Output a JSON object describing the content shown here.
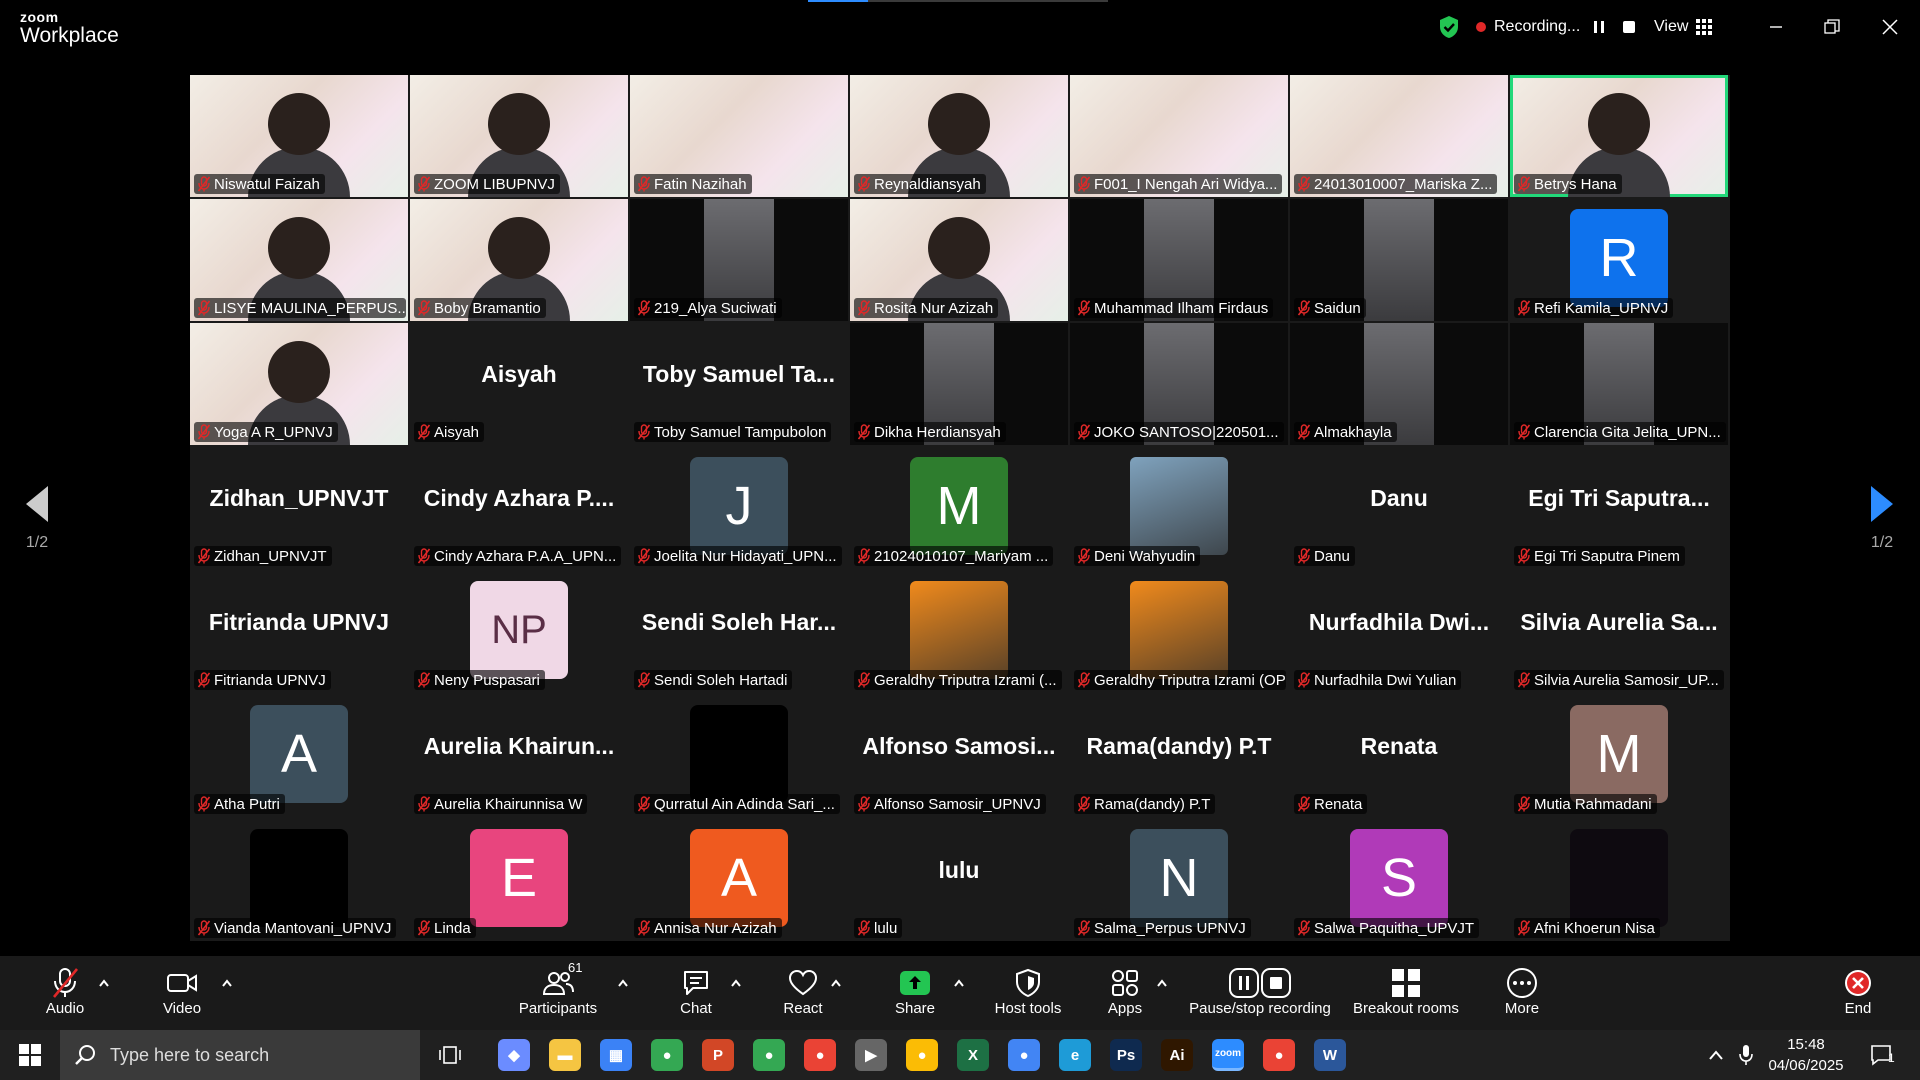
{
  "app": {
    "logo_top": "zoom",
    "logo_bottom": "Workplace"
  },
  "status": {
    "recording_label": "Recording...",
    "view_label": "View"
  },
  "pager": {
    "left": "1/2",
    "right": "1/2"
  },
  "colors": {
    "accent": "#2d8cff",
    "active_speaker": "#23d87a",
    "recording_dot": "#e02828",
    "share_green": "#23c552"
  },
  "participants": [
    {
      "name": "Niswatul Faizah",
      "kind": "video"
    },
    {
      "name": "ZOOM LIBUPNVJ",
      "kind": "video"
    },
    {
      "name": "Fatin Nazihah",
      "kind": "video-plain"
    },
    {
      "name": "Reynaldiansyah",
      "kind": "video"
    },
    {
      "name": "F001_I Nengah Ari Widya...",
      "kind": "video-plain"
    },
    {
      "name": "24013010007_Mariska Z...",
      "kind": "video-plain"
    },
    {
      "name": "Betrys Hana",
      "kind": "video",
      "active": true
    },
    {
      "name": "LISYE MAULINA_PERPUS...",
      "kind": "video"
    },
    {
      "name": "Boby Bramantio",
      "kind": "video"
    },
    {
      "name": "219_Alya Suciwati",
      "kind": "cam"
    },
    {
      "name": "Rosita Nur Azizah",
      "kind": "video"
    },
    {
      "name": "Muhammad Ilham Firdaus",
      "kind": "cam"
    },
    {
      "name": "Saidun",
      "kind": "cam"
    },
    {
      "name": "Refi Kamila_UPNVJ",
      "kind": "avatar",
      "initials": "R",
      "color": "#0e72ed"
    },
    {
      "name": "Yoga A R_UPNVJ",
      "kind": "video"
    },
    {
      "name": "Aisyah",
      "kind": "text",
      "display": "Aisyah"
    },
    {
      "name": "Toby Samuel Tampubolon",
      "kind": "text",
      "display": "Toby Samuel Ta..."
    },
    {
      "name": "Dikha Herdiansyah",
      "kind": "cam"
    },
    {
      "name": "JOKO SANTOSO|220501...",
      "kind": "cam"
    },
    {
      "name": "Almakhayla",
      "kind": "cam"
    },
    {
      "name": "Clarencia Gita Jelita_UPN...",
      "kind": "cam"
    },
    {
      "name": "Zidhan_UPNVJT",
      "kind": "text",
      "display": "Zidhan_UPNVJT"
    },
    {
      "name": "Cindy Azhara P.A.A_UPN...",
      "kind": "text",
      "display": "Cindy Azhara P...."
    },
    {
      "name": "Joelita Nur Hidayati_UPN...",
      "kind": "avatar",
      "initials": "J",
      "color": "#3c4f5c"
    },
    {
      "name": "21024010107_Mariyam ...",
      "kind": "avatar",
      "initials": "M",
      "color": "#2e7d2e"
    },
    {
      "name": "Deni Wahyudin",
      "kind": "photo",
      "color": "#7fa2bd"
    },
    {
      "name": "Danu",
      "kind": "text",
      "display": "Danu"
    },
    {
      "name": "Egi Tri Saputra Pinem",
      "kind": "text",
      "display": "Egi Tri Saputra..."
    },
    {
      "name": "Fitrianda UPNVJ",
      "kind": "text",
      "display": "Fitrianda UPNVJ"
    },
    {
      "name": "Neny Puspasari",
      "kind": "avatar",
      "initials": "NP",
      "color": "#f0d8e6",
      "fg": "#5a2e46"
    },
    {
      "name": "Sendi Soleh Hartadi",
      "kind": "text",
      "display": "Sendi Soleh Har..."
    },
    {
      "name": "Geraldhy Triputra Izrami (...",
      "kind": "photo",
      "color": "#f08a1c"
    },
    {
      "name": "Geraldhy Triputra Izrami (OP)",
      "kind": "photo",
      "color": "#f08a1c"
    },
    {
      "name": "Nurfadhila Dwi Yulian",
      "kind": "text",
      "display": "Nurfadhila Dwi..."
    },
    {
      "name": "Silvia Aurelia Samosir_UP...",
      "kind": "text",
      "display": "Silvia Aurelia Sa..."
    },
    {
      "name": "Atha Putri",
      "kind": "avatar",
      "initials": "A",
      "color": "#3c4f5c"
    },
    {
      "name": "Aurelia Khairunnisa W",
      "kind": "text",
      "display": "Aurelia Khairun..."
    },
    {
      "name": "Qurratul Ain Adinda Sari_...",
      "kind": "avatar",
      "initials": "",
      "color": "#000000"
    },
    {
      "name": "Alfonso Samosir_UPNVJ",
      "kind": "text",
      "display": "Alfonso Samosi..."
    },
    {
      "name": "Rama(dandy) P.T",
      "kind": "text",
      "display": "Rama(dandy) P.T"
    },
    {
      "name": "Renata",
      "kind": "text",
      "display": "Renata"
    },
    {
      "name": "Mutia Rahmadani",
      "kind": "avatar",
      "initials": "M",
      "color": "#8a6a62"
    },
    {
      "name": "Vianda Mantovani_UPNVJ",
      "kind": "avatar",
      "initials": "",
      "color": "#000000"
    },
    {
      "name": "Linda",
      "kind": "avatar",
      "initials": "E",
      "color": "#e8457e"
    },
    {
      "name": "Annisa Nur Azizah",
      "kind": "avatar",
      "initials": "A",
      "color": "#ef5a1f"
    },
    {
      "name": "lulu",
      "kind": "text",
      "display": "lulu"
    },
    {
      "name": "Salma_Perpus UPNVJ",
      "kind": "avatar",
      "initials": "N",
      "color": "#3c4f5c"
    },
    {
      "name": "Salwa Paquitha_UPVJT",
      "kind": "avatar",
      "initials": "S",
      "color": "#b03ab8"
    },
    {
      "name": "Afni Khoerun Nisa",
      "kind": "avatar",
      "initials": "",
      "color": "#0e0a10"
    }
  ],
  "toolbar": {
    "audio": "Audio",
    "video": "Video",
    "participants": "Participants",
    "participants_count": "61",
    "chat": "Chat",
    "react": "React",
    "share": "Share",
    "host_tools": "Host tools",
    "apps": "Apps",
    "pause_recording": "Pause/stop recording",
    "breakout": "Breakout rooms",
    "more": "More",
    "end": "End"
  },
  "taskbar": {
    "search_placeholder": "Type here to search",
    "time": "15:48",
    "date": "04/06/2025",
    "notification_count": "1",
    "apps": [
      {
        "name": "copilot-icon",
        "color": "#6b8cff",
        "glyph": "◆"
      },
      {
        "name": "file-explorer-icon",
        "color": "#f5c542",
        "glyph": "▬"
      },
      {
        "name": "store-icon",
        "color": "#3b82f6",
        "glyph": "▦"
      },
      {
        "name": "chrome-icon",
        "color": "#34a853",
        "glyph": "●"
      },
      {
        "name": "powerpoint-icon",
        "color": "#d24726",
        "glyph": "P"
      },
      {
        "name": "chrome-profile-icon",
        "color": "#34a853",
        "glyph": "●"
      },
      {
        "name": "chrome-profile-2-icon",
        "color": "#ea4335",
        "glyph": "●"
      },
      {
        "name": "media-player-icon",
        "color": "#666666",
        "glyph": "▶"
      },
      {
        "name": "chrome-profile-3-icon",
        "color": "#fbbc05",
        "glyph": "●"
      },
      {
        "name": "excel-icon",
        "color": "#1d7044",
        "glyph": "X"
      },
      {
        "name": "chrome-profile-4-icon",
        "color": "#4285f4",
        "glyph": "●"
      },
      {
        "name": "edge-icon",
        "color": "#1e9bd7",
        "glyph": "e"
      },
      {
        "name": "photoshop-icon",
        "color": "#0f2a4f",
        "glyph": "Ps"
      },
      {
        "name": "illustrator-icon",
        "color": "#2f1700",
        "glyph": "Ai"
      },
      {
        "name": "zoom-taskbar-icon",
        "color": "#2d8cff",
        "glyph": "zoom"
      },
      {
        "name": "chrome-profile-5-icon",
        "color": "#ea4335",
        "glyph": "●"
      },
      {
        "name": "word-icon",
        "color": "#2b579a",
        "glyph": "W"
      }
    ]
  }
}
